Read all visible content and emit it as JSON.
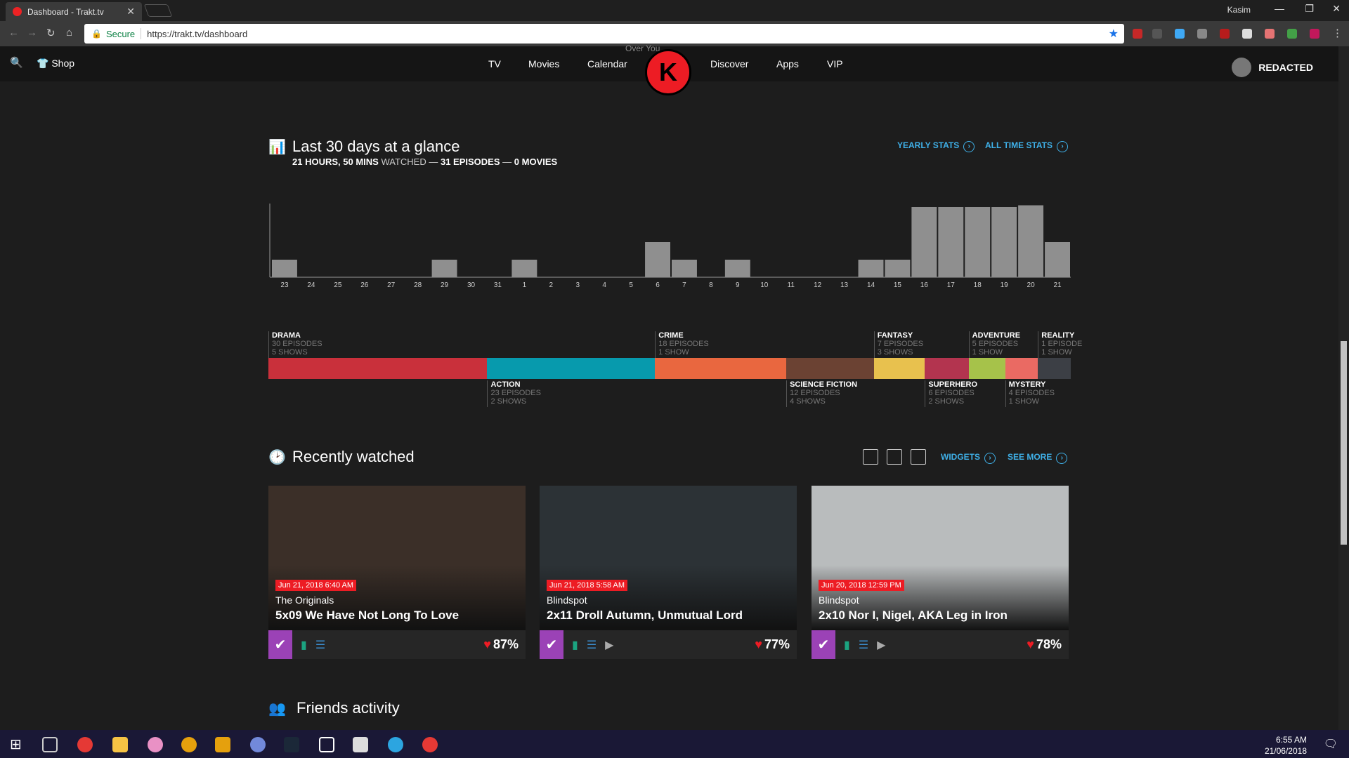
{
  "browser": {
    "tab_title": "Dashboard - Trakt.tv",
    "tab_close": "✕",
    "user": "Kasim",
    "secure_label": "Secure",
    "url": "https://trakt.tv/dashboard"
  },
  "header": {
    "shop": "Shop",
    "nav": [
      "TV",
      "Movies",
      "Calendar",
      "Discover",
      "Apps",
      "VIP"
    ],
    "logo_caption": "Over You",
    "user": "REDACTED"
  },
  "stats": {
    "title": "Last 30 days at a glance",
    "hours": "21 HOURS, 50 MINS",
    "watched": "WATCHED",
    "episodes": "31 EPISODES",
    "movies": "0 MOVIES",
    "sep": "—",
    "yearly": "YEARLY STATS",
    "alltime": "ALL TIME STATS"
  },
  "chart_data": {
    "type": "bar",
    "categories": [
      "23",
      "24",
      "25",
      "26",
      "27",
      "28",
      "29",
      "30",
      "31",
      "1",
      "2",
      "3",
      "4",
      "5",
      "6",
      "7",
      "8",
      "9",
      "10",
      "11",
      "12",
      "13",
      "14",
      "15",
      "16",
      "17",
      "18",
      "19",
      "20",
      "21"
    ],
    "values": [
      1,
      0,
      0,
      0,
      0,
      0,
      1,
      0,
      0,
      1,
      0,
      0,
      0,
      0,
      2,
      1,
      0,
      1,
      0,
      0,
      0,
      0,
      1,
      1,
      4,
      4,
      4,
      4,
      4.1,
      2
    ],
    "ylim": [
      0,
      4.2
    ]
  },
  "genres": [
    {
      "name": "DRAMA",
      "episodes": "30 EPISODES",
      "shows": "5 SHOWS",
      "color": "#c9303b",
      "weight": 30
    },
    {
      "name": "ACTION",
      "episodes": "23 EPISODES",
      "shows": "2 SHOWS",
      "color": "#079aad",
      "weight": 23
    },
    {
      "name": "CRIME",
      "episodes": "18 EPISODES",
      "shows": "1 SHOW",
      "color": "#e9673f",
      "weight": 18
    },
    {
      "name": "SCIENCE FICTION",
      "episodes": "12 EPISODES",
      "shows": "4 SHOWS",
      "color": "#6b4233",
      "weight": 12
    },
    {
      "name": "FANTASY",
      "episodes": "7 EPISODES",
      "shows": "3 SHOWS",
      "color": "#e8c14e",
      "weight": 7
    },
    {
      "name": "SUPERHERO",
      "episodes": "6 EPISODES",
      "shows": "2 SHOWS",
      "color": "#b3344f",
      "weight": 6
    },
    {
      "name": "ADVENTURE",
      "episodes": "5 EPISODES",
      "shows": "1 SHOW",
      "color": "#a6c24a",
      "weight": 5
    },
    {
      "name": "MYSTERY",
      "episodes": "4 EPISODES",
      "shows": "1 SHOW",
      "color": "#ea6a63",
      "weight": 4.5
    },
    {
      "name": "REALITY",
      "episodes": "1 EPISODE",
      "shows": "1 SHOW",
      "color": "#3c3f45",
      "weight": 4.5
    }
  ],
  "recent": {
    "title": "Recently watched",
    "widgets": "WIDGETS",
    "see_more": "SEE MORE",
    "cards": [
      {
        "date": "Jun 21, 2018 6:40 AM",
        "show": "The Originals",
        "episode": "5x09 We Have Not Long To Love",
        "rating": "87%",
        "bg": "#3b2f28"
      },
      {
        "date": "Jun 21, 2018 5:58 AM",
        "show": "Blindspot",
        "episode": "2x11 Droll Autumn, Unmutual Lord",
        "rating": "77%",
        "bg": "#2c3236"
      },
      {
        "date": "Jun 20, 2018 12:59 PM",
        "show": "Blindspot",
        "episode": "2x10 Nor I, Nigel, AKA Leg in Iron",
        "rating": "78%",
        "bg": "#b9bcbd"
      }
    ]
  },
  "friends": {
    "title": "Friends activity"
  },
  "taskbar": {
    "time": "6:55 AM",
    "date": "21/06/2018"
  }
}
